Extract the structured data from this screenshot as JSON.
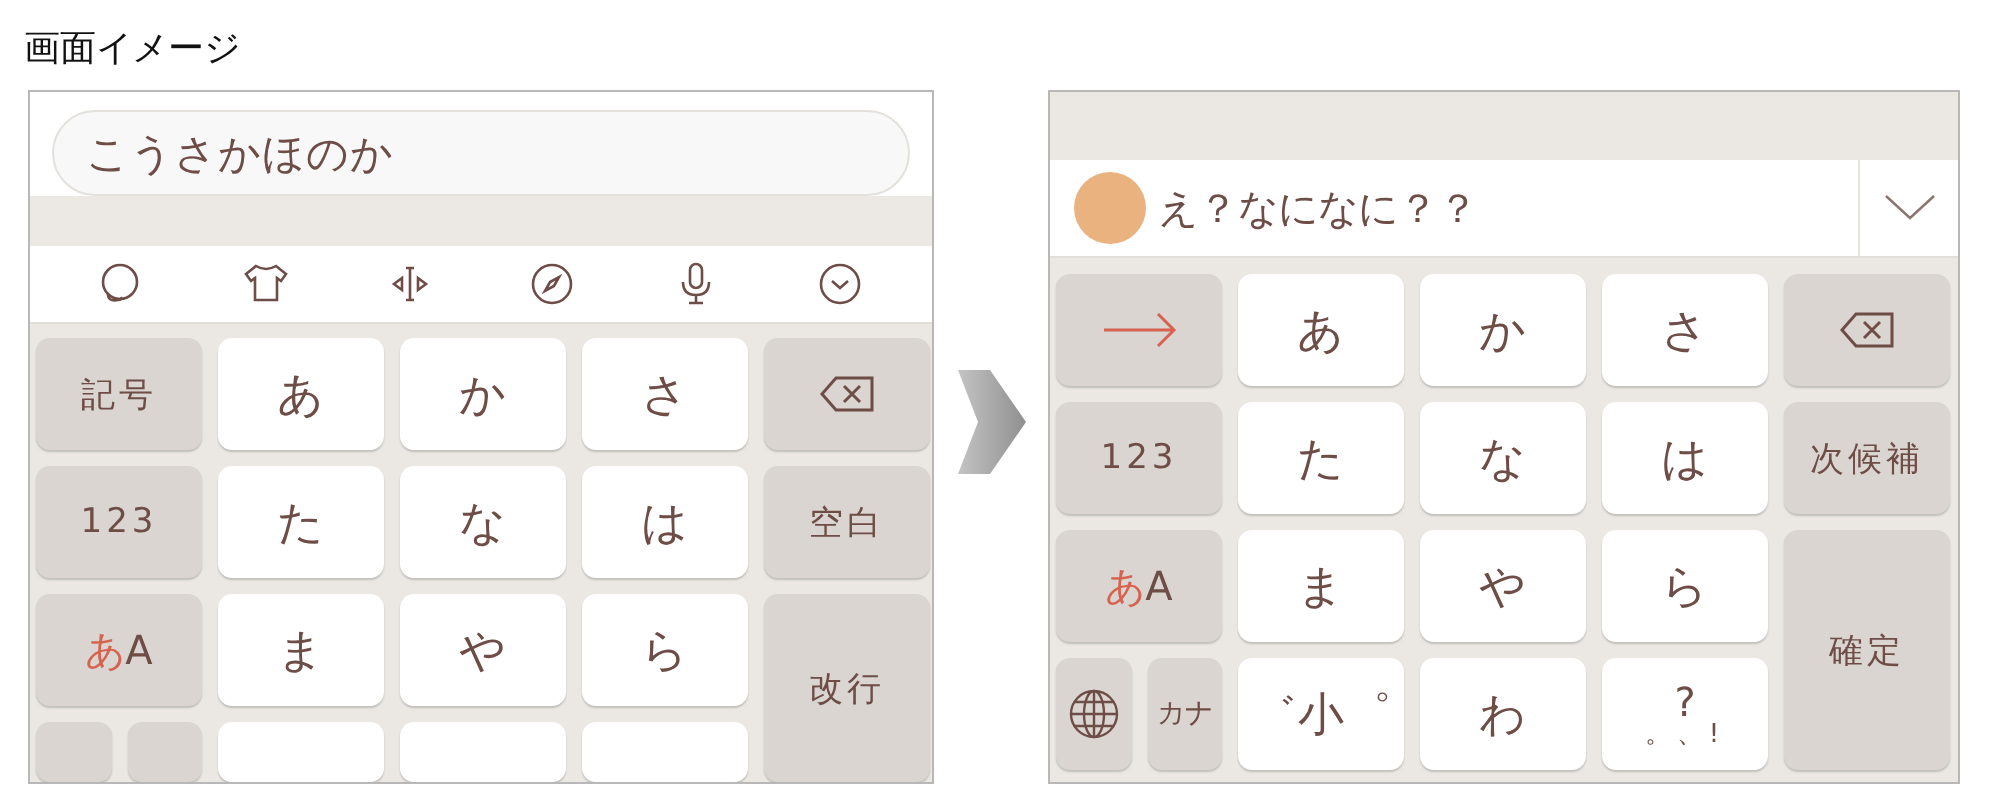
{
  "title": "画面イメージ",
  "screens": [
    {
      "kind": "search",
      "search": {
        "value": "こうさかほのか"
      },
      "keys": [
        {
          "kind": "func",
          "label": "記号"
        },
        {
          "kind": "kana",
          "label": "あ"
        },
        {
          "kind": "kana",
          "label": "か"
        },
        {
          "kind": "kana",
          "label": "さ"
        },
        {
          "kind": "backspace"
        },
        {
          "kind": "func",
          "label": "123"
        },
        {
          "kind": "kana",
          "label": "た"
        },
        {
          "kind": "kana",
          "label": "な"
        },
        {
          "kind": "kana",
          "label": "は"
        },
        {
          "kind": "func",
          "label": "空白"
        },
        {
          "kind": "mode",
          "accent": "あ",
          "label": "A"
        },
        {
          "kind": "kana",
          "label": "ま"
        },
        {
          "kind": "kana",
          "label": "や"
        },
        {
          "kind": "kana",
          "label": "ら"
        },
        {
          "kind": "tall",
          "label": "改行"
        },
        {
          "kind": "split",
          "keys": [
            {
              "kind": "func"
            },
            {
              "kind": "func"
            }
          ]
        },
        {
          "kind": "kana"
        },
        {
          "kind": "kana"
        },
        {
          "kind": "kana"
        }
      ]
    },
    {
      "kind": "candidate",
      "candidate": {
        "text": "え？なになに？？"
      },
      "keys": [
        {
          "kind": "arrow"
        },
        {
          "kind": "kana",
          "label": "あ"
        },
        {
          "kind": "kana",
          "label": "か"
        },
        {
          "kind": "kana",
          "label": "さ"
        },
        {
          "kind": "backspace"
        },
        {
          "kind": "func",
          "label": "123"
        },
        {
          "kind": "kana",
          "label": "た"
        },
        {
          "kind": "kana",
          "label": "な"
        },
        {
          "kind": "kana",
          "label": "は"
        },
        {
          "kind": "func",
          "label": "次候補"
        },
        {
          "kind": "mode",
          "accent": "あ",
          "label": "A"
        },
        {
          "kind": "kana",
          "label": "ま"
        },
        {
          "kind": "kana",
          "label": "や"
        },
        {
          "kind": "kana",
          "label": "ら"
        },
        {
          "kind": "tall",
          "label": "確定"
        },
        {
          "kind": "split",
          "keys": [
            {
              "kind": "globe"
            },
            {
              "kind": "func",
              "label": "カナ"
            }
          ]
        },
        {
          "kind": "kana",
          "label": "゛小゜"
        },
        {
          "kind": "kana",
          "label": "わ"
        },
        {
          "kind": "punct",
          "label": "?",
          "sublabel": "。、!"
        }
      ]
    }
  ]
}
